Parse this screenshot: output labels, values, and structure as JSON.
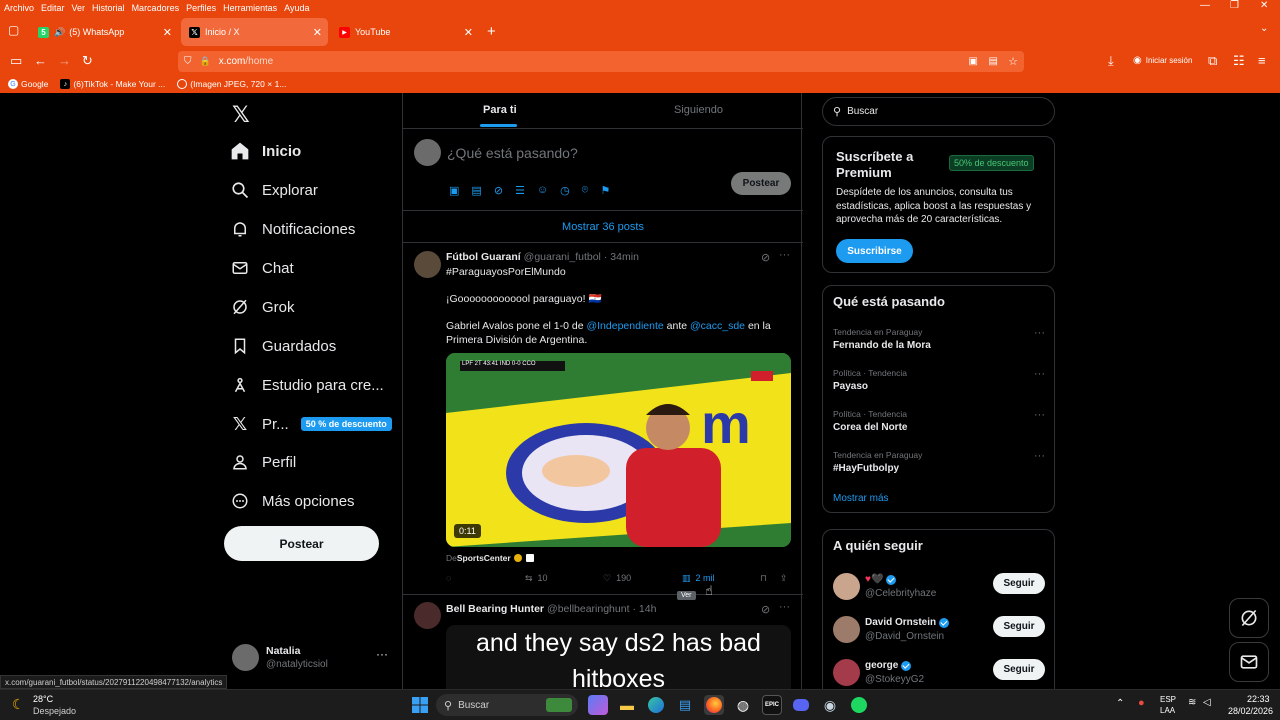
{
  "menubar": {
    "items": [
      "Archivo",
      "Editar",
      "Ver",
      "Historial",
      "Marcadores",
      "Perfiles",
      "Herramientas",
      "Ayuda"
    ]
  },
  "tabs": [
    {
      "title": "(5) WhatsApp",
      "active": false
    },
    {
      "title": "Inicio / X",
      "active": true
    },
    {
      "title": "YouTube",
      "active": false
    }
  ],
  "navbar": {
    "url_domain": "x.com",
    "url_path": "/home",
    "signin_label": "Iniciar sesión"
  },
  "bookmarks": [
    {
      "label": "Google"
    },
    {
      "label": "(6)TikTok - Make Your ..."
    },
    {
      "label": "(Imagen JPEG, 720 × 1..."
    }
  ],
  "leftnav": {
    "items": [
      {
        "label": "Inicio",
        "icon": "home-icon",
        "bold": true
      },
      {
        "label": "Explorar",
        "icon": "search-icon"
      },
      {
        "label": "Notificaciones",
        "icon": "bell-icon"
      },
      {
        "label": "Chat",
        "icon": "mail-icon"
      },
      {
        "label": "Grok",
        "icon": "grok-icon"
      },
      {
        "label": "Guardados",
        "icon": "bookmark-icon"
      },
      {
        "label": "Estudio para cre...",
        "icon": "creator-studio-icon"
      },
      {
        "label": "Pr...",
        "icon": "x-premium-icon"
      },
      {
        "label": "Perfil",
        "icon": "user-icon"
      },
      {
        "label": "Más opciones",
        "icon": "more-circle-icon"
      }
    ],
    "premium_badge": "50 % de descuento",
    "post_button": "Postear",
    "account": {
      "name": "Natalia",
      "handle": "@natalyticsiol"
    }
  },
  "feed": {
    "tabs": [
      "Para ti",
      "Siguiendo"
    ],
    "composer_placeholder": "¿Qué está pasando?",
    "composer_post": "Postear",
    "show_posts": "Mostrar 36 posts",
    "tweets": [
      {
        "name": "Fútbol Guaraní",
        "handle": "@guarani_futbol",
        "time": "· 34min",
        "hashtag": "#ParaguayosPorElMundo",
        "line1": "¡Gooooooooooool paraguayo! 🇵🇾",
        "line2a": "Gabriel Avalos pone el 1-0 de ",
        "mention1": "@Independiente",
        "line2b": " ante ",
        "mention2": "@cacc_sde",
        "line2c": " en la",
        "line3": "Primera División de Argentina.",
        "video_duration": "0:11",
        "scorebug": "LPF  2T 43:41  IND 0-0 CCO",
        "source_prefix": "De ",
        "source": "SportsCenter",
        "replies": "",
        "reposts": "10",
        "likes": "190",
        "views": "2 mil",
        "tooltip": "Ver"
      },
      {
        "name": "Bell Bearing Hunter",
        "handle": "@bellbearinghunt",
        "time": "· 14h",
        "image_text1": "and they say ds2 has bad",
        "image_text2": "hitboxes"
      }
    ]
  },
  "right": {
    "search_placeholder": "Buscar",
    "premium": {
      "title": "Suscríbete a Premium",
      "badge": "50% de descuento",
      "desc": "Despídete de los anuncios, consulta tus estadísticas, aplica boost a las respuestas y aprovecha más de 20 características.",
      "button": "Suscribirse"
    },
    "trends_title": "Qué está pasando",
    "trends": [
      {
        "category": "Tendencia en Paraguay",
        "name": "Fernando de la Mora"
      },
      {
        "category": "Política · Tendencia",
        "name": "Payaso"
      },
      {
        "category": "Política · Tendencia",
        "name": "Corea del Norte"
      },
      {
        "category": "Tendencia en Paraguay",
        "name": "#HayFutbolpy"
      }
    ],
    "show_more": "Mostrar más",
    "follow_title": "A quién seguir",
    "follow": [
      {
        "name": "♥🖤",
        "handle": "@Celebrityhaze",
        "button": "Seguir"
      },
      {
        "name": "David Ornstein",
        "handle": "@David_Ornstein",
        "button": "Seguir"
      },
      {
        "name": "george",
        "handle": "@StokeyyG2",
        "button": "Seguir"
      }
    ]
  },
  "status_url": "x.com/guarani_futbol/status/2027911220498477132/analytics",
  "taskbar": {
    "weather_temp": "28°C",
    "weather_desc": "Despejado",
    "search_placeholder": "Buscar",
    "lang1": "ESP",
    "lang2": "LAA",
    "time": "22:33",
    "date": "28/02/2026"
  },
  "colors": {
    "browser_orange": "#e8460c",
    "x_blue": "#1d9bf0",
    "bg": "#000000"
  }
}
